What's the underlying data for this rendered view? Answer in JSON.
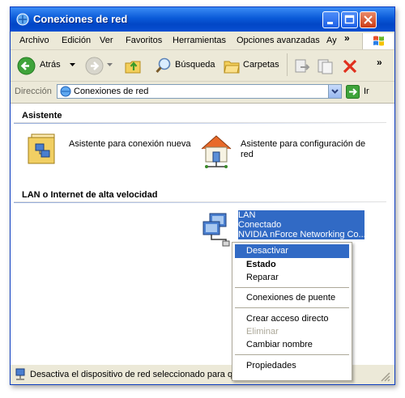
{
  "window": {
    "title": "Conexiones de red"
  },
  "menu": {
    "items": [
      "Archivo",
      "Edición",
      "Ver",
      "Favoritos",
      "Herramientas",
      "Opciones avanzadas",
      "Ay"
    ],
    "overflow": "»"
  },
  "toolbar": {
    "back": "Atrás",
    "search": "Búsqueda",
    "folders": "Carpetas",
    "overflow": "»"
  },
  "address": {
    "label": "Dirección",
    "value": "Conexiones de red",
    "go": "Ir"
  },
  "sections": {
    "wizard": {
      "title": "Asistente",
      "items": [
        {
          "label": "Asistente para conexión nueva"
        },
        {
          "label": "Asistente para configuración de red"
        }
      ]
    },
    "lan": {
      "title": "LAN o Internet de alta velocidad",
      "connection": {
        "name": "LAN",
        "status": "Conectado",
        "device": "NVIDIA nForce Networking Co..."
      }
    }
  },
  "context_menu": {
    "items": [
      {
        "label": "Desactivar",
        "state": "selected"
      },
      {
        "label": "Estado",
        "state": "bold"
      },
      {
        "label": "Reparar",
        "state": "normal"
      },
      {
        "label": "Conexiones de puente",
        "state": "normal"
      },
      {
        "label": "Crear acceso directo",
        "state": "normal"
      },
      {
        "label": "Eliminar",
        "state": "disabled"
      },
      {
        "label": "Cambiar nombre",
        "state": "normal"
      },
      {
        "label": "Propiedades",
        "state": "normal"
      }
    ]
  },
  "status": {
    "text": "Desactiva el dispositivo de red seleccionado para que no se use."
  },
  "colors": {
    "titlebar": "#0a5ad8",
    "selection": "#316ac5",
    "chrome": "#ece9d8",
    "close_button": "#cc3a14"
  }
}
